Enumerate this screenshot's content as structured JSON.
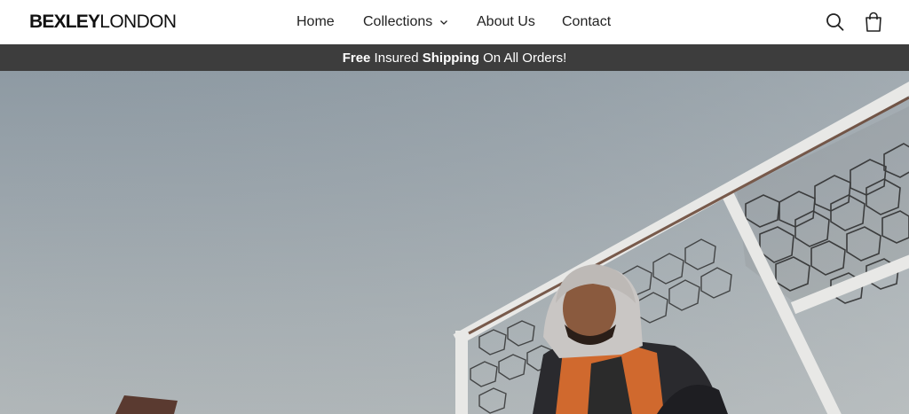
{
  "brand": {
    "bold": "BEXLEY",
    "light": "LONDON"
  },
  "nav": {
    "home": "Home",
    "collections": "Collections",
    "about": "About Us",
    "contact": "Contact"
  },
  "icons": {
    "search": "search-icon",
    "cart": "shopping-bag-icon",
    "dropdown": "chevron-down-icon"
  },
  "announcement": {
    "part1": "Free",
    "part2": " Insured ",
    "part3": "Shipping",
    "part4": " On All Orders!"
  },
  "colors": {
    "announce_bg": "#3d3d3d",
    "header_bg": "#ffffff",
    "text": "#222222"
  }
}
